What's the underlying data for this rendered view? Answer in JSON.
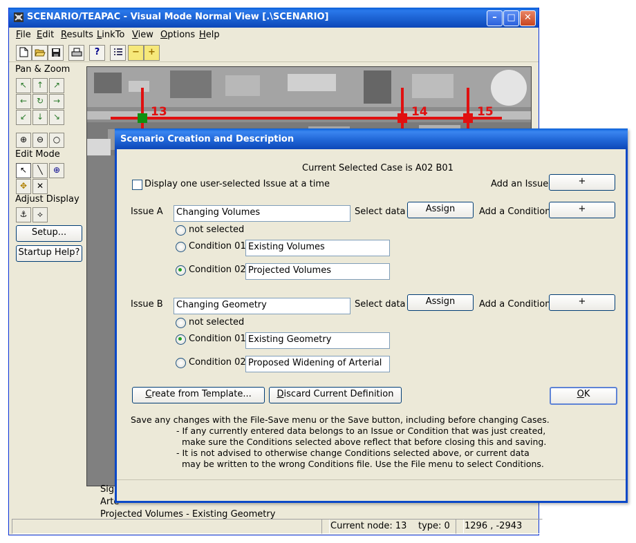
{
  "window": {
    "title": "SCENARIO/TEAPAC - Visual Mode Normal View [.\\SCENARIO]",
    "controls": {
      "minimize": "–",
      "maximize": "□",
      "close": "✕"
    }
  },
  "menu": [
    "File",
    "Edit",
    "Results",
    "LinkTo",
    "View",
    "Options",
    "Help"
  ],
  "toolbar_icons": [
    "new-file-icon",
    "open-folder-icon",
    "save-icon",
    "print-icon",
    "help-icon",
    "list-icon",
    "minus-icon",
    "plus-icon"
  ],
  "toolbar_glyphs": {
    "help": "?",
    "minus": "−",
    "plus": "+"
  },
  "left_panel": {
    "pan_zoom_label": "Pan & Zoom",
    "edit_mode_label": "Edit Mode",
    "adjust_display_label": "Adjust Display",
    "setup_button": "Setup...",
    "startup_help_button": "Startup Help?"
  },
  "map": {
    "nodes": [
      "13",
      "14",
      "15"
    ]
  },
  "status_lines": [
    "Sign",
    "Arte",
    "Projected Volumes - Existing Geometry"
  ],
  "statusbar": {
    "current_node": "Current node: 13",
    "type": "type: 0",
    "coords": "1296 , -2943"
  },
  "dialog": {
    "title": "Scenario Creation and Description",
    "current_case": "Current Selected Case is  A02 B01",
    "display_one_issue_label": "Display one user-selected Issue at a time",
    "display_one_issue_checked": false,
    "add_issue_label": "Add an Issue",
    "add_issue_button": "+",
    "issues": [
      {
        "label": "Issue A",
        "name": "Changing Volumes",
        "select_data_label": "Select data",
        "assign_button": "Assign",
        "add_condition_label": "Add a Condition",
        "add_condition_button": "+",
        "not_selected_label": "not selected",
        "conditions": [
          {
            "label": "Condition 01",
            "value": "Existing Volumes",
            "selected": false
          },
          {
            "label": "Condition 02",
            "value": "Projected Volumes",
            "selected": true
          }
        ]
      },
      {
        "label": "Issue B",
        "name": "Changing Geometry",
        "select_data_label": "Select data",
        "assign_button": "Assign",
        "add_condition_label": "Add a Condition",
        "add_condition_button": "+",
        "not_selected_label": "not selected",
        "conditions": [
          {
            "label": "Condition 01",
            "value": "Existing Geometry",
            "selected": true
          },
          {
            "label": "Condition 02",
            "value": "Proposed Widening of Arterial",
            "selected": false
          }
        ]
      }
    ],
    "create_template_button": "Create from Template...",
    "discard_button": "Discard Current Definition",
    "ok_button": "OK",
    "notes": [
      "Save any changes with the File-Save menu or the Save button, including before changing Cases.",
      "- If any currently entered data belongs to an Issue or Condition that was just created,",
      "make sure the Conditions selected above reflect that before closing this and saving.",
      "- It is not advised to otherwise change Conditions selected above, or current data",
      "may be written to the wrong Conditions file.  Use the File menu to select Conditions."
    ]
  },
  "colors": {
    "titlebar": "#0a5fd8",
    "window_bg": "#ece9d8",
    "route_red": "#e01010",
    "node_green": "#109010"
  }
}
